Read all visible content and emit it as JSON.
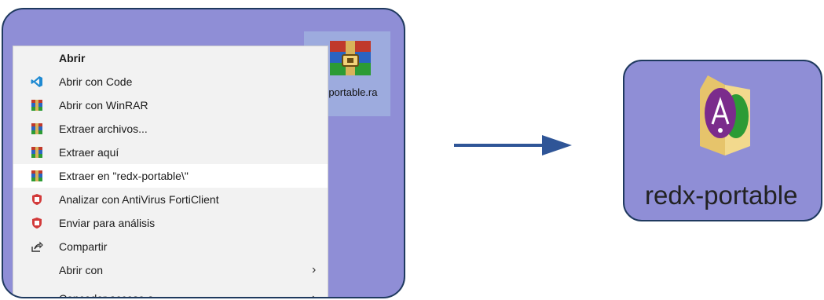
{
  "left": {
    "file_label": "-portable.ra",
    "menu": {
      "items": [
        {
          "label": "Abrir",
          "icon": "none",
          "bold": true
        },
        {
          "label": "Abrir con Code",
          "icon": "vscode-icon"
        },
        {
          "label": "Abrir con WinRAR",
          "icon": "winrar-icon"
        },
        {
          "label": "Extraer archivos...",
          "icon": "winrar-icon"
        },
        {
          "label": "Extraer aquí",
          "icon": "winrar-icon"
        },
        {
          "label": "Extraer en \"redx-portable\\\"",
          "icon": "winrar-icon",
          "highlighted": true
        },
        {
          "label": "Analizar con AntiVirus FortiClient",
          "icon": "forticlient-icon"
        },
        {
          "label": "Enviar para análisis",
          "icon": "forticlient-icon"
        },
        {
          "label": "Compartir",
          "icon": "share-icon"
        },
        {
          "label": "Abrir con",
          "icon": "none",
          "submenu": true
        },
        {
          "label": "Conceder acceso a",
          "icon": "none",
          "submenu": true
        }
      ]
    }
  },
  "right": {
    "folder_label": "redx-portable"
  },
  "colors": {
    "panel_bg": "#8f8ed6",
    "panel_border": "#1f3a5f",
    "arrow": "#2f5597",
    "menu_bg": "#f2f2f2"
  }
}
